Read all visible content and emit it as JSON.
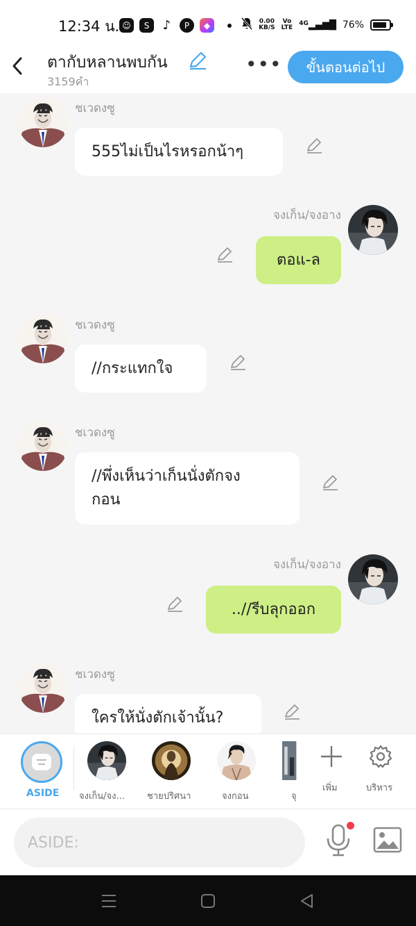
{
  "status_bar": {
    "time": "12:34 น.",
    "net_speed_top": "0.00",
    "net_speed_bottom": "KB/S",
    "volte_top": "Vo",
    "volte_bottom": "LTE",
    "network": "4G",
    "battery": "76%"
  },
  "header": {
    "title": "ตากับหลานพบกัน",
    "subtitle": "3159คำ",
    "next_button": "ขั้นตอนต่อไป"
  },
  "messages": [
    {
      "sender": "ชเวดงซู",
      "side": "left",
      "text_lines": [
        "555ไม่เป็นไรหรอกน้าๆ"
      ]
    },
    {
      "sender": "จงเก็น/จงอาง",
      "side": "right",
      "text_lines": [
        "ตอแ-ล"
      ]
    },
    {
      "sender": "ชเวดงซู",
      "side": "left",
      "text_lines": [
        "//กระแทกใจ"
      ]
    },
    {
      "sender": "ชเวดงซู",
      "side": "left",
      "text_lines": [
        "//พึ่งเห็นว่าเก็นนั่งตักจง",
        "กอน"
      ]
    },
    {
      "sender": "จงเก็น/จงอาง",
      "side": "right",
      "text_lines": [
        "..//รีบลุกออก"
      ]
    },
    {
      "sender": "ชเวดงซู",
      "side": "left",
      "text_lines": [
        "ใครให้นั่งตักเจ้านั้น?"
      ]
    }
  ],
  "character_bar": {
    "aside_label": "ASIDE",
    "characters": [
      {
        "label": "จงเก็น/จง..."
      },
      {
        "label": "ชายปริศนา"
      },
      {
        "label": "จงกอน"
      },
      {
        "label": "จุ"
      }
    ],
    "add_label": "เพิ่ม",
    "manage_label": "บริหาร"
  },
  "input": {
    "placeholder": "ASIDE:"
  },
  "colors": {
    "accent": "#4aa8ef",
    "right_bubble": "#cdef86",
    "left_bubble": "#ffffff",
    "background": "#f5f5f5",
    "mic_dot": "#f03c4c"
  }
}
